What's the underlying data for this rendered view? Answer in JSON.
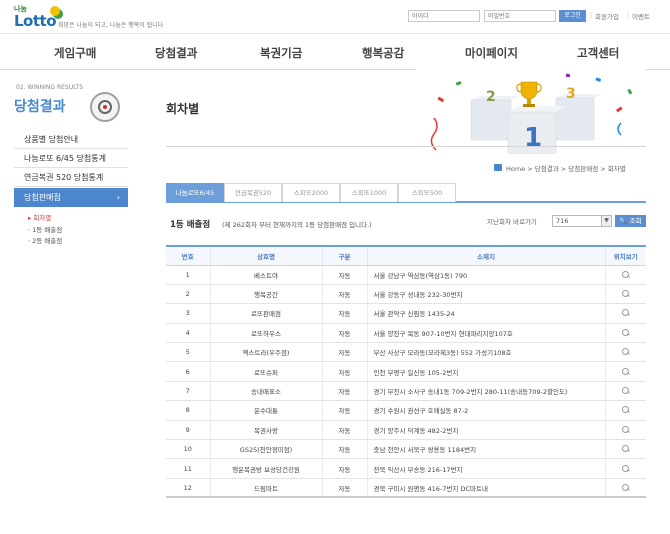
{
  "header": {
    "logo_top": "나눔",
    "logo_main": "Lotto",
    "slogan": "희망은 나눔이 되고, 나눔은 행복이 됩니다",
    "id_placeholder": "아이디",
    "pw_placeholder": "비밀번호",
    "login_label": "로그인",
    "signup_label": "회원가입",
    "event_label": "이벤트",
    "separator": "|"
  },
  "nav": {
    "items": [
      "게임구매",
      "당첨결과",
      "복권기금",
      "행복공감",
      "마이페이지",
      "고객센터"
    ]
  },
  "sidebar": {
    "eng_title": "02. WINNING RESULTS",
    "title": "당첨결과",
    "items": [
      "상품별 당첨안내",
      "나눔로또 6/45 당첨통계",
      "연금복권 520 당첨통계",
      "당첨판매점"
    ],
    "active_arrow": "›",
    "subitems": [
      "회차별",
      "1등 배출점",
      "2등 배출점"
    ]
  },
  "content": {
    "title": "회차별",
    "breadcrumb": "Home  >  당첨결과  >  당첨판매점  >  회차별"
  },
  "tabs": [
    "나눔로또6/45",
    "연금복권520",
    "스피또2000",
    "스피또1000",
    "스피또500"
  ],
  "section": {
    "title": "1등 배출점",
    "note": "(제 262회차 부터 현재까지의 1등 당첨판매점 입니다.)",
    "jump_label": "지난회차 바로가기",
    "selected_round": "716",
    "view_label": "조회"
  },
  "table": {
    "headers": [
      "번호",
      "상호명",
      "구분",
      "소재지",
      "위치보기"
    ],
    "rows": [
      [
        "1",
        "베스트야",
        "자동",
        "서울 강남구 역삼동(역삼1동) 790"
      ],
      [
        "2",
        "행복공간",
        "자동",
        "서울 강동구 성내동 232-30번지"
      ],
      [
        "3",
        "로또판매점",
        "자동",
        "서울 관악구 신림동 1435-24"
      ],
      [
        "4",
        "로또하우스",
        "자동",
        "서울 양천구 목동 907-10번지 현대파리지앙107호"
      ],
      [
        "5",
        "엑스트라(우주점)",
        "자동",
        "부산 사상구 모라동(모라제3동) 552 가성기108호"
      ],
      [
        "6",
        "로또슈퍼",
        "자동",
        "인천 부평구 일신동 105-2번지"
      ],
      [
        "7",
        "송내매표소",
        "자동",
        "경기 부천시 소사구 송내1동 709-2번지 280-11(송내동709-2할인도)"
      ],
      [
        "8",
        "운수대통",
        "자동",
        "경기 수원시 권선구 호매실동 87-2"
      ],
      [
        "9",
        "복권사랑",
        "자동",
        "경기 양주시 덕계동 482-2번지"
      ],
      [
        "10",
        "GS25(천안정미점)",
        "자동",
        "충남 천안시 서북구 쌍용동 1184번지"
      ],
      [
        "11",
        "행운복권방 보성당건강원",
        "자동",
        "전북 익산시 부송동 216-17번지"
      ],
      [
        "12",
        "드림마트",
        "자동",
        "경북 구미시 원평동 416-7번지 DC마트내"
      ]
    ]
  }
}
